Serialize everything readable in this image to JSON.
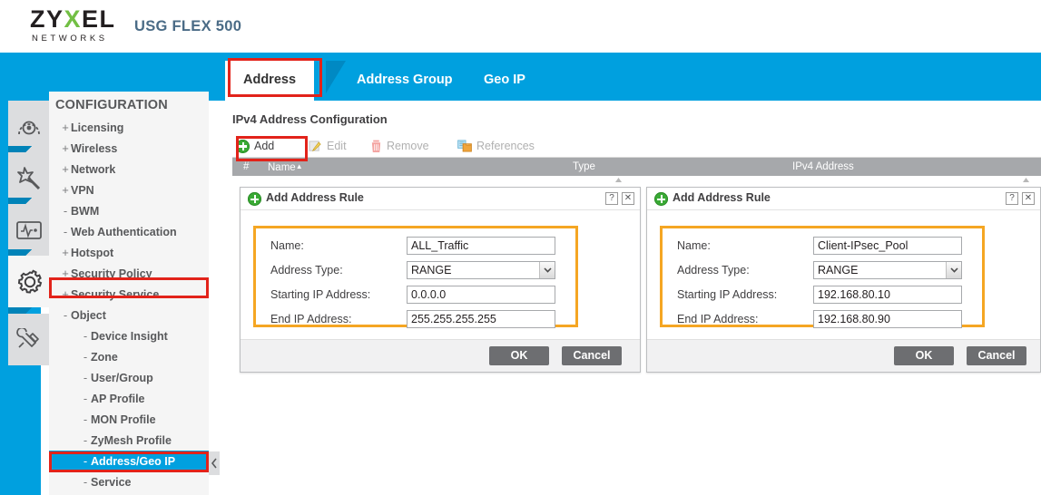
{
  "brand": {
    "name_part1": "ZY",
    "name_x": "X",
    "name_part2": "EL",
    "tagline": "NETWORKS",
    "model": "USG FLEX 500"
  },
  "tabs": [
    {
      "label": "Address",
      "active": true
    },
    {
      "label": "Address Group",
      "active": false
    },
    {
      "label": "Geo IP",
      "active": false
    }
  ],
  "sidebar": {
    "title": "CONFIGURATION",
    "rail_icons": [
      "dashboard-gauge-icon",
      "wizard-wand-icon",
      "monitor-icon",
      "configuration-gear-icon",
      "maintenance-tools-icon"
    ],
    "items": [
      {
        "marker": "+",
        "label": "Licensing",
        "level": 1,
        "selected": false
      },
      {
        "marker": "+",
        "label": "Wireless",
        "level": 1,
        "selected": false
      },
      {
        "marker": "+",
        "label": "Network",
        "level": 1,
        "selected": false
      },
      {
        "marker": "+",
        "label": "VPN",
        "level": 1,
        "selected": false
      },
      {
        "marker": "-",
        "label": "BWM",
        "level": 1,
        "selected": false
      },
      {
        "marker": "-",
        "label": "Web Authentication",
        "level": 1,
        "selected": false
      },
      {
        "marker": "+",
        "label": "Hotspot",
        "level": 1,
        "selected": false
      },
      {
        "marker": "+",
        "label": "Security Policy",
        "level": 1,
        "selected": false
      },
      {
        "marker": "+",
        "label": "Security Service",
        "level": 1,
        "selected": false
      },
      {
        "marker": "-",
        "label": "Object",
        "level": 1,
        "selected": false
      },
      {
        "marker": "-",
        "label": "Device Insight",
        "level": 2,
        "selected": false
      },
      {
        "marker": "-",
        "label": "Zone",
        "level": 2,
        "selected": false
      },
      {
        "marker": "-",
        "label": "User/Group",
        "level": 2,
        "selected": false
      },
      {
        "marker": "-",
        "label": "AP Profile",
        "level": 2,
        "selected": false
      },
      {
        "marker": "-",
        "label": "MON Profile",
        "level": 2,
        "selected": false
      },
      {
        "marker": "-",
        "label": "ZyMesh Profile",
        "level": 2,
        "selected": false
      },
      {
        "marker": "-",
        "label": "Address/Geo IP",
        "level": 2,
        "selected": true
      },
      {
        "marker": "-",
        "label": "Service",
        "level": 2,
        "selected": false
      }
    ],
    "collapse_icon": "chevron-left-icon"
  },
  "main": {
    "section_title": "IPv4 Address Configuration",
    "toolbar": [
      {
        "label": "Add",
        "icon": "plus-circle-icon",
        "enabled": true
      },
      {
        "label": "Edit",
        "icon": "pencil-icon",
        "enabled": false
      },
      {
        "label": "Remove",
        "icon": "trash-icon",
        "enabled": false
      },
      {
        "label": "References",
        "icon": "references-icon",
        "enabled": false
      }
    ],
    "table_headers": {
      "index": "#",
      "name": "Name",
      "sort_arrow": "▲",
      "type": "Type",
      "ipv4": "IPv4 Address"
    }
  },
  "dialogs": [
    {
      "title": "Add Address Rule",
      "icon": "plus-circle-icon",
      "help_label": "?",
      "close_label": "✕",
      "fields": [
        {
          "label": "Name:",
          "value": "ALL_Traffic",
          "kind": "text"
        },
        {
          "label": "Address Type:",
          "value": "RANGE",
          "kind": "select"
        },
        {
          "label": "Starting IP Address:",
          "value": "0.0.0.0",
          "kind": "text"
        },
        {
          "label": "End IP Address:",
          "value": "255.255.255.255",
          "kind": "text"
        }
      ],
      "ok_label": "OK",
      "cancel_label": "Cancel"
    },
    {
      "title": "Add Address Rule",
      "icon": "plus-circle-icon",
      "help_label": "?",
      "close_label": "✕",
      "fields": [
        {
          "label": "Name:",
          "value": "Client-IPsec_Pool",
          "kind": "text"
        },
        {
          "label": "Address Type:",
          "value": "RANGE",
          "kind": "select"
        },
        {
          "label": "Starting IP Address:",
          "value": "192.168.80.10",
          "kind": "text"
        },
        {
          "label": "End IP Address:",
          "value": "192.168.80.90",
          "kind": "text"
        }
      ],
      "ok_label": "OK",
      "cancel_label": "Cancel"
    }
  ],
  "colors": {
    "brand_blue": "#00a0df",
    "brand_green": "#72bf44",
    "highlight_red": "#e2231a",
    "highlight_orange": "#f5a623",
    "table_header_gray": "#a6a8ab",
    "button_gray": "#6d6e71"
  }
}
